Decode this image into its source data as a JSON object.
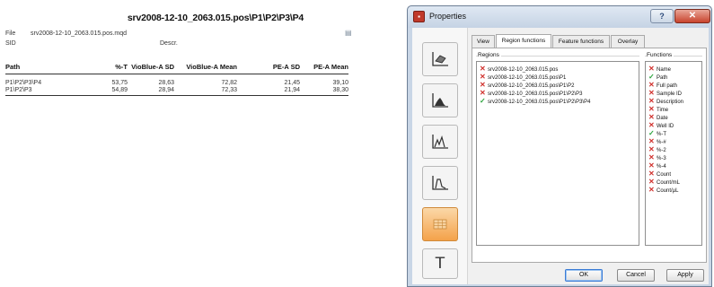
{
  "report": {
    "title": "srv2008-12-10_2063.015.pos\\P1\\P2\\P3\\P4",
    "file_label": "File",
    "file_value": "srv2008-12-10_2063.015.pos.mqd",
    "sid_label": "SID",
    "descr_label": "Descr.",
    "columns": [
      "Path",
      "%-T",
      "VioBlue-A SD",
      "VioBlue-A Mean",
      "PE-A SD",
      "PE-A Mean"
    ],
    "rows": [
      [
        "P1\\P2\\P3\\P4",
        "53,75",
        "28,63",
        "72,82",
        "21,45",
        "39,10"
      ],
      [
        "P1\\P2\\P3",
        "54,89",
        "28,94",
        "72,33",
        "21,94",
        "38,30"
      ]
    ]
  },
  "dialog": {
    "title": "Properties",
    "help_label": "?",
    "close_label": "✕",
    "tabs": [
      "View",
      "Region functions",
      "Feature functions",
      "Overlay"
    ],
    "active_tab": "Region functions",
    "regions_label": "Regions",
    "functions_label": "Functions",
    "regions": [
      {
        "label": "srv2008-12-10_2063.015.pos",
        "checked": false
      },
      {
        "label": "srv2008-12-10_2063.015.pos\\P1",
        "checked": false
      },
      {
        "label": "srv2008-12-10_2063.015.pos\\P1\\P2",
        "checked": false
      },
      {
        "label": "srv2008-12-10_2063.015.pos\\P1\\P2\\P3",
        "checked": false
      },
      {
        "label": "srv2008-12-10_2063.015.pos\\P1\\P2\\P3\\P4",
        "checked": true
      }
    ],
    "functions": [
      {
        "label": "Name",
        "checked": false
      },
      {
        "label": "Path",
        "checked": true
      },
      {
        "label": "Full path",
        "checked": false
      },
      {
        "label": "Sample ID",
        "checked": false
      },
      {
        "label": "Description",
        "checked": false
      },
      {
        "label": "Time",
        "checked": false
      },
      {
        "label": "Date",
        "checked": false
      },
      {
        "label": "Well ID",
        "checked": false
      },
      {
        "label": "%-T",
        "checked": true
      },
      {
        "label": "%-#",
        "checked": false
      },
      {
        "label": "%-2",
        "checked": false
      },
      {
        "label": "%-3",
        "checked": false
      },
      {
        "label": "%-4",
        "checked": false
      },
      {
        "label": "Count",
        "checked": false
      },
      {
        "label": "Count/mL",
        "checked": false
      },
      {
        "label": "Count/µL",
        "checked": false
      }
    ],
    "sidebar_icons": [
      "gate-plot-icon",
      "histogram-icon",
      "overlay-plot-icon",
      "line-plot-icon",
      "statistics-table-icon",
      "text-icon",
      "grid-icon"
    ],
    "text_tool_glyph": "T",
    "ok_label": "OK",
    "cancel_label": "Cancel",
    "apply_label": "Apply",
    "colors": {
      "check": "#2aa33b",
      "cross": "#d0312d",
      "active_tool": "#f4a24a",
      "close": "#c8432d"
    }
  }
}
